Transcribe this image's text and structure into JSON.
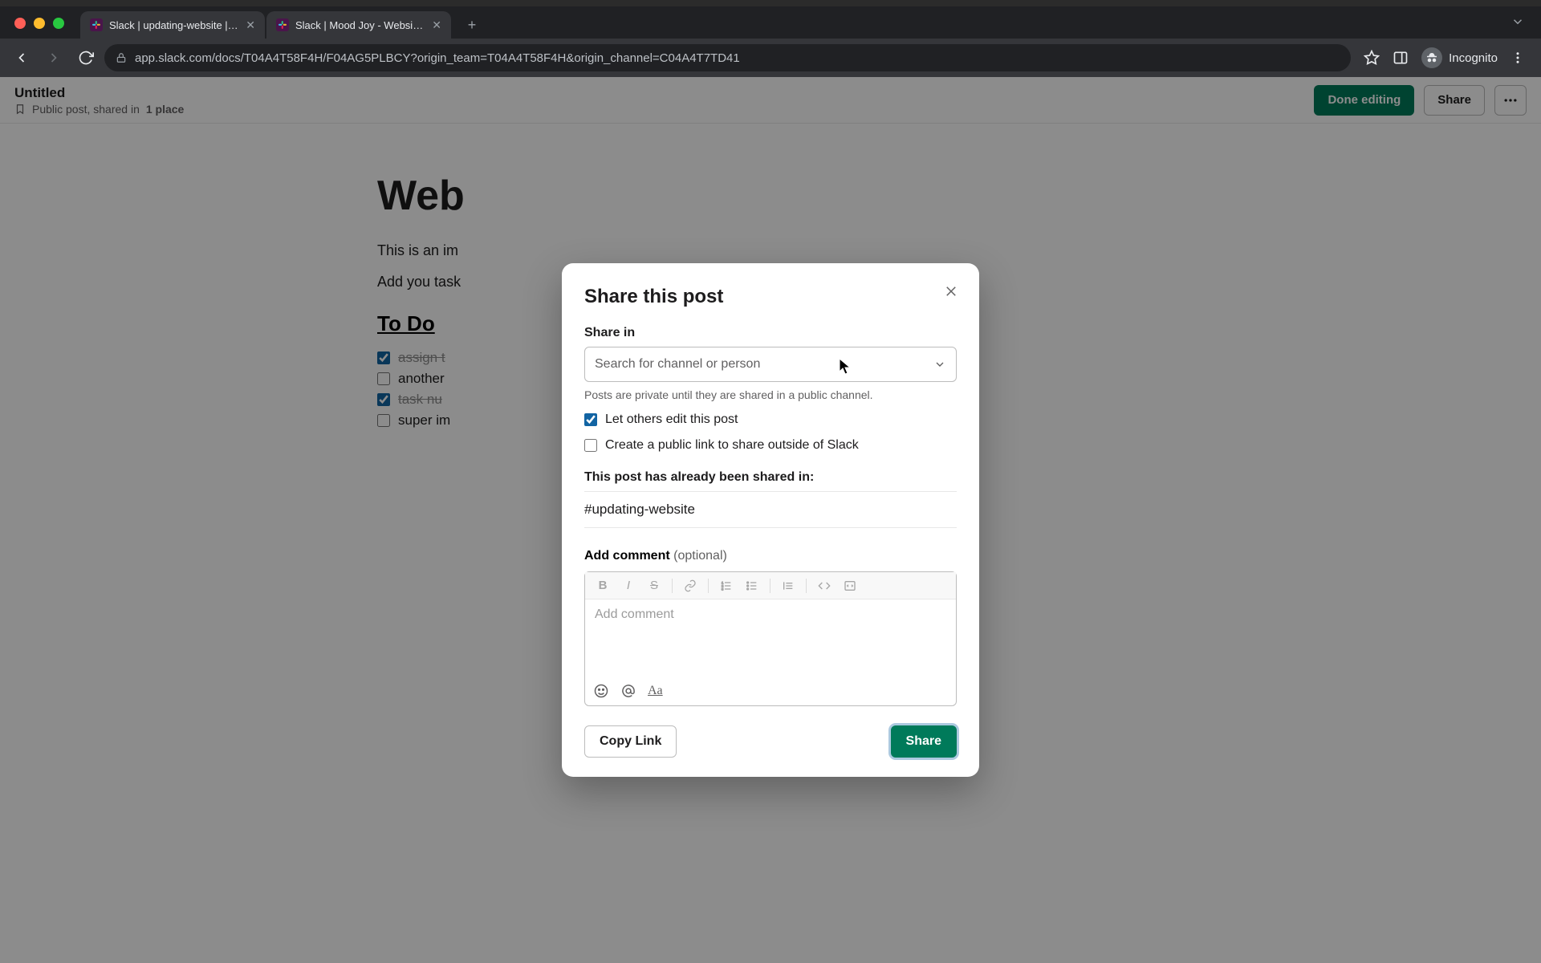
{
  "browser": {
    "tabs": [
      {
        "title": "Slack | updating-website | Mood…"
      },
      {
        "title": "Slack | Mood Joy - Website Re…"
      }
    ],
    "url": "app.slack.com/docs/T04A4T58F4H/F04AG5PLBCY?origin_team=T04A4T58F4H&origin_channel=C04A4T7TD41",
    "incognito_label": "Incognito"
  },
  "doc": {
    "title": "Untitled",
    "subtitle_prefix": "Public post, shared in ",
    "subtitle_bold": "1 place",
    "done_label": "Done editing",
    "share_label": "Share",
    "heading": "Web",
    "p1": "This is an im",
    "p2": "Add you task",
    "todo_heading": "To Do",
    "todos": [
      {
        "text": "assign t",
        "checked": true
      },
      {
        "text": "another",
        "checked": false
      },
      {
        "text": "task nu",
        "checked": true
      },
      {
        "text": "super im",
        "checked": false
      }
    ]
  },
  "modal": {
    "title": "Share this post",
    "share_in_label": "Share in",
    "combo_placeholder": "Search for channel or person",
    "help": "Posts are private until they are shared in a public channel.",
    "chk_edit": "Let others edit this post",
    "chk_public": "Create a public link to share outside of Slack",
    "already_shared_label": "This post has already been shared in:",
    "shared_channel": "#updating-website",
    "comment_label": "Add comment",
    "comment_optional": "(optional)",
    "comment_placeholder": "Add comment",
    "copy_link": "Copy Link",
    "share": "Share"
  }
}
